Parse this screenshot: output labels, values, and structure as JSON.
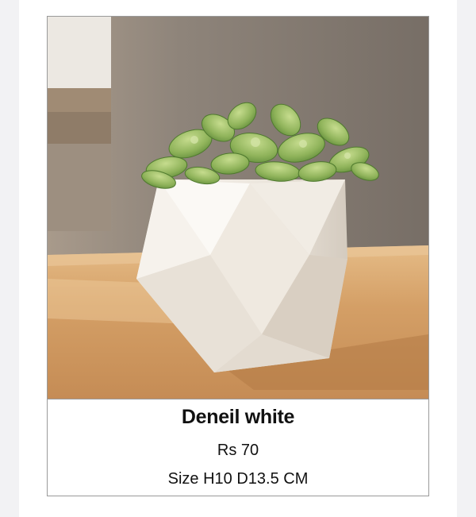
{
  "product": {
    "image_alt": "White geometric ceramic pot with succulents on a wooden table",
    "name": "Deneil white",
    "price": "Rs 70",
    "size": "Size H10 D13.5 CM"
  },
  "colors": {
    "page_background": "#f2f2f4",
    "card_border": "#9a9a9a",
    "wall": "#8a8178",
    "table": "#d6a46c",
    "pot": "#f3efe9",
    "leaf": "#8fb35a"
  }
}
